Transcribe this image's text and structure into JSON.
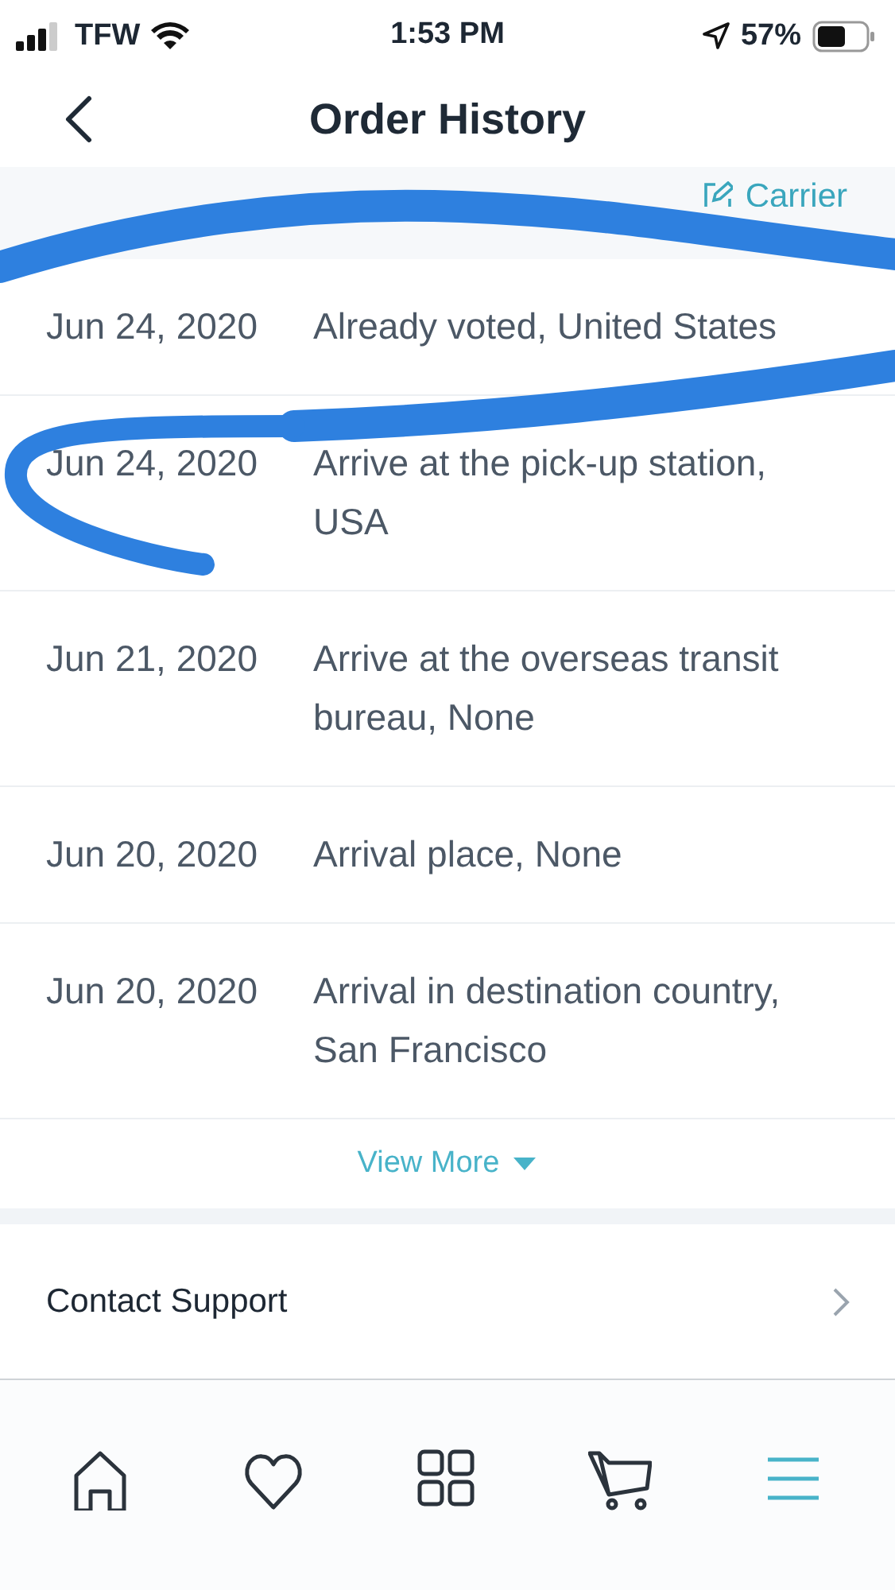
{
  "status_bar": {
    "carrier": "TFW",
    "time": "1:53 PM",
    "battery": "57%"
  },
  "header": {
    "title": "Order History"
  },
  "tracking": {
    "carrier_link": "Carrier"
  },
  "events": [
    {
      "date": "Jun 24, 2020",
      "description": "Already voted, United States"
    },
    {
      "date": "Jun 24, 2020",
      "description": "Arrive at the pick-up station, USA"
    },
    {
      "date": "Jun 21, 2020",
      "description": "Arrive at the overseas transit bureau, None"
    },
    {
      "date": "Jun 20, 2020",
      "description": "Arrival place, None"
    },
    {
      "date": "Jun 20, 2020",
      "description": "Arrival in destination country, San Francisco"
    }
  ],
  "view_more": "View More",
  "menu_items": [
    {
      "label": "Contact Support"
    }
  ],
  "tab_bar": [
    {
      "kind": "home",
      "selected": false
    },
    {
      "kind": "favorites",
      "selected": false
    },
    {
      "kind": "categories",
      "selected": false
    },
    {
      "kind": "cart",
      "selected": false
    },
    {
      "kind": "menu",
      "selected": true
    }
  ]
}
